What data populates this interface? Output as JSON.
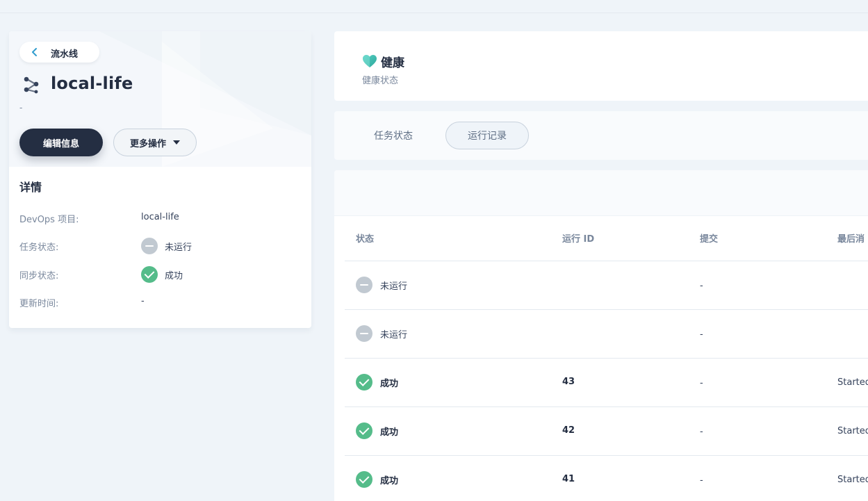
{
  "pipeline": {
    "back_label": "流水线",
    "name": "local-life",
    "description": "-",
    "edit_label": "编辑信息",
    "more_label": "更多操作"
  },
  "details": {
    "title": "详情",
    "rows": [
      {
        "key": "DevOps 项目:",
        "value": "local-life"
      },
      {
        "key": "任务状态:",
        "value": "未运行",
        "status": "none"
      },
      {
        "key": "同步状态:",
        "value": "成功",
        "status": "ok"
      },
      {
        "key": "更新时间:",
        "value": "-"
      }
    ]
  },
  "health": {
    "title": "健康",
    "subtitle": "健康状态",
    "heart_color": "#3dc4b4"
  },
  "tabs": [
    {
      "label": "任务状态",
      "active": false
    },
    {
      "label": "运行记录",
      "active": true
    }
  ],
  "table": {
    "columns": [
      "状态",
      "运行 ID",
      "提交",
      "最后消"
    ],
    "rows": [
      {
        "status": "未运行",
        "status_type": "none",
        "id": "",
        "commit": "-",
        "message": ""
      },
      {
        "status": "未运行",
        "status_type": "none",
        "id": "",
        "commit": "-",
        "message": ""
      },
      {
        "status": "成功",
        "status_type": "ok",
        "id": "43",
        "commit": "-",
        "message": "Started"
      },
      {
        "status": "成功",
        "status_type": "ok",
        "id": "42",
        "commit": "-",
        "message": "Started"
      },
      {
        "status": "成功",
        "status_type": "ok",
        "id": "41",
        "commit": "-",
        "message": "Started"
      }
    ]
  },
  "colors": {
    "primary_dark": "#242e42",
    "success": "#55bc8a",
    "muted": "#c1c9d1",
    "page_bg": "#eff4f9"
  },
  "icons": {
    "back": "chevron-left-icon",
    "pipeline": "pipeline-icon",
    "health": "heart-icon",
    "dropdown": "caret-down-icon",
    "status_ok": "check-circle-icon",
    "status_none": "minus-circle-icon"
  }
}
